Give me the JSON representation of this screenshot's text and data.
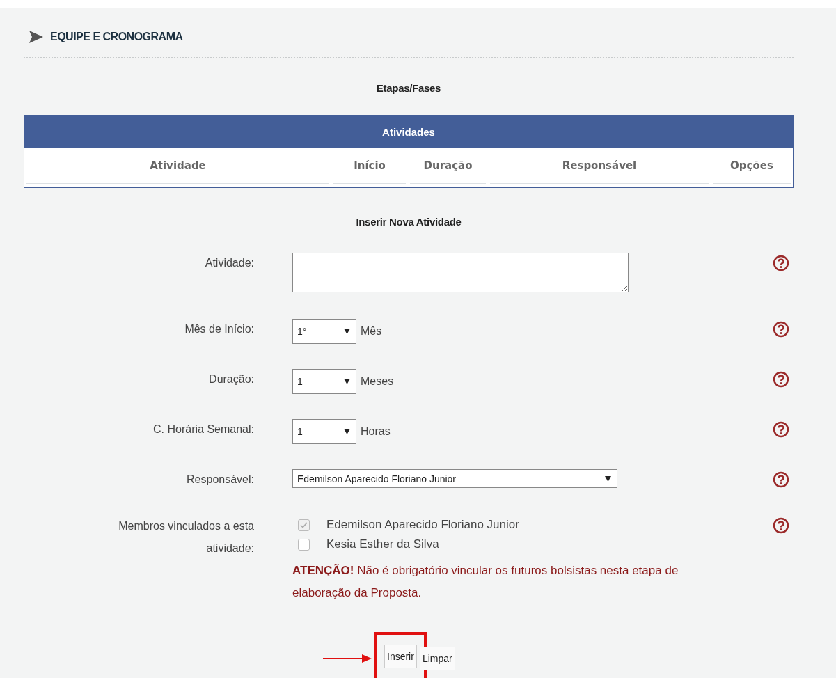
{
  "section": {
    "title": "EQUIPE E CRONOGRAMA"
  },
  "stages_title": "Etapas/Fases",
  "table": {
    "title": "Atividades",
    "columns": [
      "Atividade",
      "Início",
      "Duração",
      "Responsável",
      "Opções"
    ]
  },
  "form": {
    "title": "Inserir Nova Atividade",
    "fields": [
      {
        "kind": "textarea",
        "label": "Atividade:"
      },
      {
        "kind": "select",
        "label": "Mês de Início:",
        "value": "1°",
        "unit": "Mês"
      },
      {
        "kind": "select",
        "label": "Duração:",
        "value": "1",
        "unit": "Meses"
      },
      {
        "kind": "select",
        "label": "C. Horária Semanal:",
        "value": "1",
        "unit": "Horas"
      },
      {
        "kind": "wide-select",
        "label": "Responsável:",
        "value": "Edemilson Aparecido Floriano Junior"
      },
      {
        "kind": "checklist",
        "label": "Membros vinculados a esta atividade:",
        "members": [
          {
            "name": "Edemilson Aparecido Floriano Junior",
            "checked": true,
            "disabled": true
          },
          {
            "name": "Kesia Esther da Silva",
            "checked": false,
            "disabled": false
          }
        ],
        "notice": "**ATENÇÃO!** Não é obrigatório vincular os futuros bolsistas nesta etapa de elaboração da Proposta."
      }
    ]
  },
  "buttons": [
    {
      "label": "Inserir",
      "highlighted": true
    },
    {
      "label": "Limpar",
      "highlighted": false
    }
  ]
}
